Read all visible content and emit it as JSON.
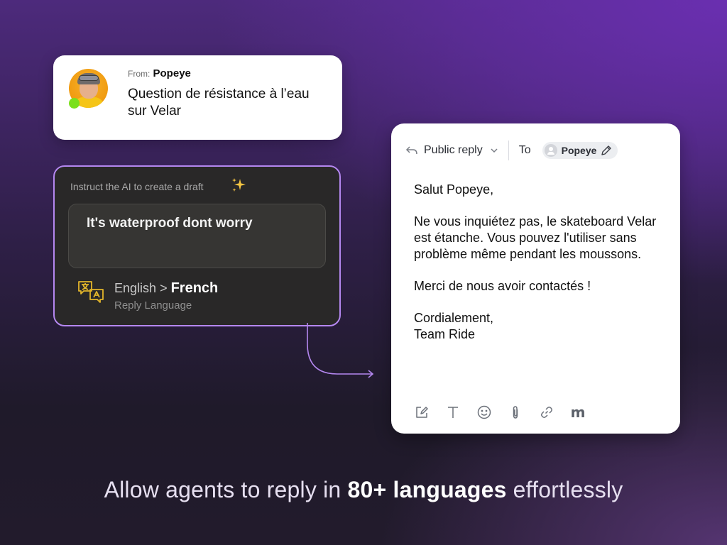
{
  "from_card": {
    "from_label": "From:",
    "sender_name": "Popeye",
    "subject": "Question de résistance à l’eau sur Velar",
    "status": "online",
    "status_color": "#7be01d"
  },
  "ai_card": {
    "instruction_label": "Instruct the AI to create a draft",
    "sparkle_icon": "✨",
    "prompt_value": "It's waterproof dont worry",
    "source_language": "English",
    "separator": ">",
    "target_language": "French",
    "language_caption": "Reply Language",
    "accent_color": "#b487f0"
  },
  "reply_card": {
    "reply_type": "Public reply",
    "to_label": "To",
    "recipient": "Popeye",
    "body": [
      "Salut Popeye,",
      "Ne vous inquiétez pas, le skateboard Velar est étanche. Vous pouvez l'utiliser sans problème même pendant les moussons.",
      "Merci de nous avoir contactés !",
      "Cordialement,",
      "Team Ride"
    ],
    "toolbar": [
      {
        "icon": "compose-icon"
      },
      {
        "icon": "text-format-icon"
      },
      {
        "icon": "emoji-icon"
      },
      {
        "icon": "attachment-icon"
      },
      {
        "icon": "link-icon"
      },
      {
        "icon": "macro-icon",
        "glyph": "m"
      }
    ]
  },
  "tagline": {
    "prefix": "Allow agents to reply in",
    "highlight": "80+ languages",
    "suffix": "effortlessly"
  }
}
